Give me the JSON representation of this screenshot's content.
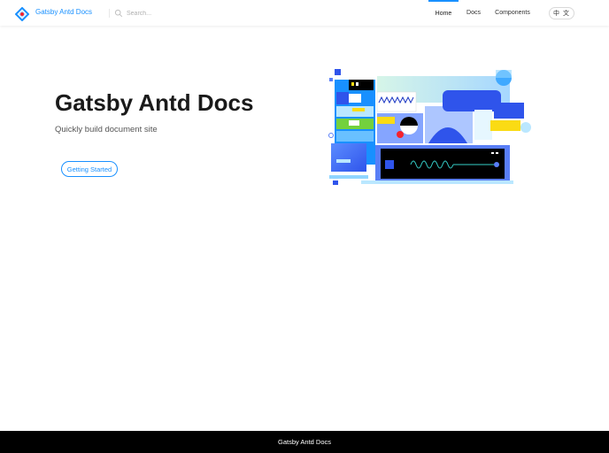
{
  "header": {
    "brand": "Gatsby Antd Docs",
    "search": {
      "placeholder": "Search..."
    },
    "nav": [
      {
        "label": "Home",
        "active": true
      },
      {
        "label": "Docs",
        "active": false
      },
      {
        "label": "Components",
        "active": false
      }
    ],
    "language_button": "中 文"
  },
  "hero": {
    "title": "Gatsby Antd Docs",
    "subtitle": "Quickly build document site",
    "cta_label": "Getting Started"
  },
  "footer": {
    "text": "Gatsby Antd Docs"
  },
  "colors": {
    "accent": "#1890ff",
    "footer_bg": "#000000",
    "title": "#1a1a1a"
  },
  "icons": {
    "logo": "ant-design-logo-icon",
    "search": "search-icon"
  }
}
